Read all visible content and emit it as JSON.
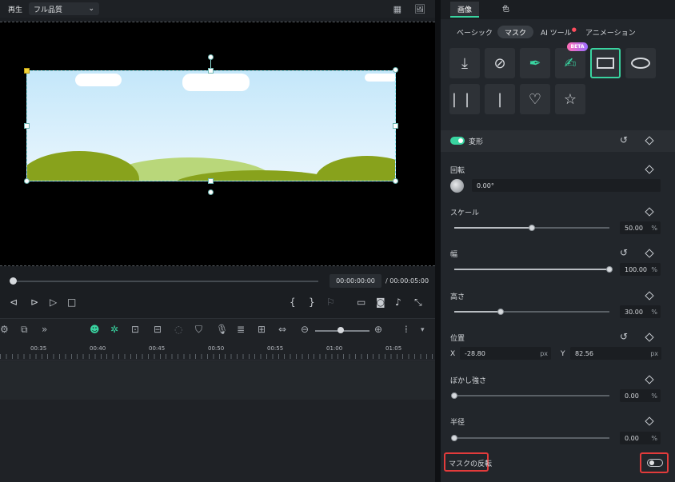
{
  "player": {
    "label": "再生",
    "quality": "フル品質"
  },
  "scrubber": {
    "current_time": "00:00:00:00",
    "separator": "/",
    "total_time": "00:00:05:00"
  },
  "timeline": {
    "ruler_labels": [
      "00:35",
      "00:40",
      "00:45",
      "00:50",
      "00:55",
      "01:00",
      "01:05"
    ]
  },
  "panel": {
    "main_tabs": [
      "画像",
      "色"
    ],
    "sub_tabs": [
      "ベーシック",
      "マスク",
      "AI ツール",
      "アニメーション"
    ],
    "beta_badge": "BETA",
    "transform": {
      "label": "変形",
      "enabled": true
    },
    "rotation": {
      "label": "回転",
      "value": "0.00°"
    },
    "scale": {
      "label": "スケール",
      "value": "50.00",
      "unit": "%",
      "level": 0.5
    },
    "width": {
      "label": "幅",
      "value": "100.00",
      "unit": "%",
      "level": 1.0
    },
    "height": {
      "label": "高さ",
      "value": "30.00",
      "unit": "%",
      "level": 0.3
    },
    "position": {
      "label": "位置",
      "x_label": "X",
      "x_value": "-28.80",
      "y_label": "Y",
      "y_value": "82.56",
      "unit": "px"
    },
    "blur": {
      "label": "ぼかし強さ",
      "value": "0.00",
      "unit": "%",
      "level": 0
    },
    "radius": {
      "label": "半径",
      "value": "0.00",
      "unit": "%",
      "level": 0
    },
    "invert_mask": {
      "label": "マスクの反転",
      "enabled": false
    }
  },
  "colors": {
    "accent": "#39d4a0",
    "highlight": "#e23b3b"
  }
}
